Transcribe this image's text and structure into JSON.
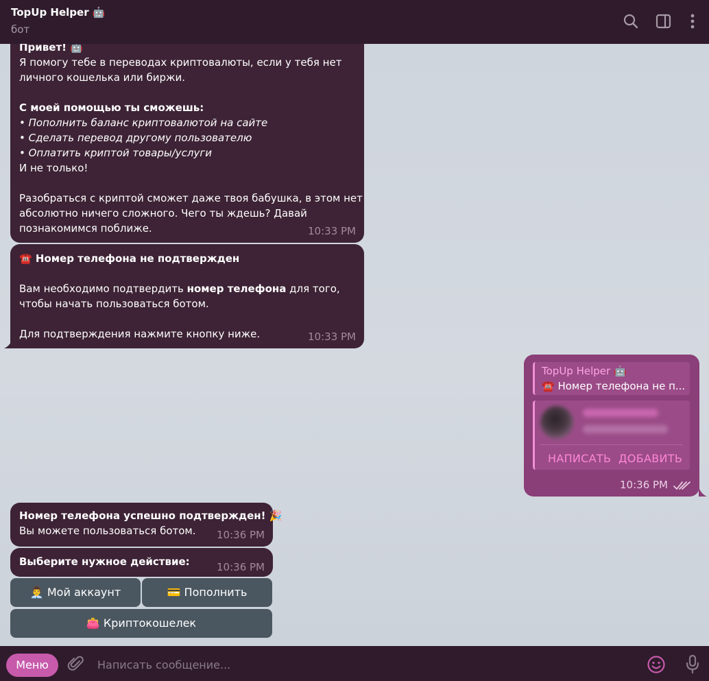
{
  "header": {
    "title": "TopUp Helper 🤖",
    "subtitle": "бот"
  },
  "messages": {
    "welcome": {
      "lines": [
        "Привет! 🤖",
        "Я помогу тебе в переводах криптовалюты, если у тебя нет",
        "личного кошелька или биржи.",
        "",
        "С моей помощью ты сможешь:",
        "• Пополнить баланс криптовалютой на сайте",
        "• Сделать перевод другому пользователю",
        "• Оплатить криптой товары/услуги",
        "И не только!",
        "",
        "Разобраться с криптой сможет даже твоя бабушка, в этом нет",
        "абсолютно ничего сложного. Чего ты ждешь? Давай",
        "познакомимся поближе."
      ],
      "time": "10:33 PM"
    },
    "phone_required": {
      "title": "☎️ Номер телефона не подтвержден",
      "body_prefix": "Вам необходимо подтвердить ",
      "body_bold": "номер телефона",
      "body_suffix": " для того,",
      "body_line2": "чтобы начать пользоваться ботом.",
      "body_line3": "Для подтверждения нажмите кнопку ниже.",
      "time": "10:33 PM"
    },
    "outgoing_contact": {
      "reply_name": "TopUp Helper 🤖",
      "reply_text": "☎️ Номер телефона не п...",
      "write_label": "НАПИСАТЬ",
      "add_label": "ДОБАВИТЬ",
      "time": "10:36 PM"
    },
    "phone_confirmed": {
      "title": "Номер телефона успешно подтвержден! 🎉",
      "body": "Вы можете пользоваться ботом.",
      "time": "10:36 PM"
    },
    "choose_action": {
      "text": "Выберите нужное действие:",
      "time": "10:36 PM"
    }
  },
  "keyboard": {
    "account": "👨‍💼 Мой аккаунт",
    "topup": "💳 Пополнить",
    "wallet": "👛 Криптокошелек"
  },
  "composer": {
    "menu_label": "Меню",
    "placeholder": "Написать сообщение..."
  },
  "colors": {
    "header_bg": "#2f1b2c",
    "incoming_bubble": "#3d2335",
    "outgoing_bubble": "#8a3f78",
    "accent": "#c75aab",
    "keyboard_button": "#4b5760"
  },
  "icons": [
    "search-icon",
    "sidebar-toggle-icon",
    "more-vertical-icon",
    "attach-icon",
    "emoji-icon",
    "microphone-icon",
    "double-check-icon"
  ]
}
